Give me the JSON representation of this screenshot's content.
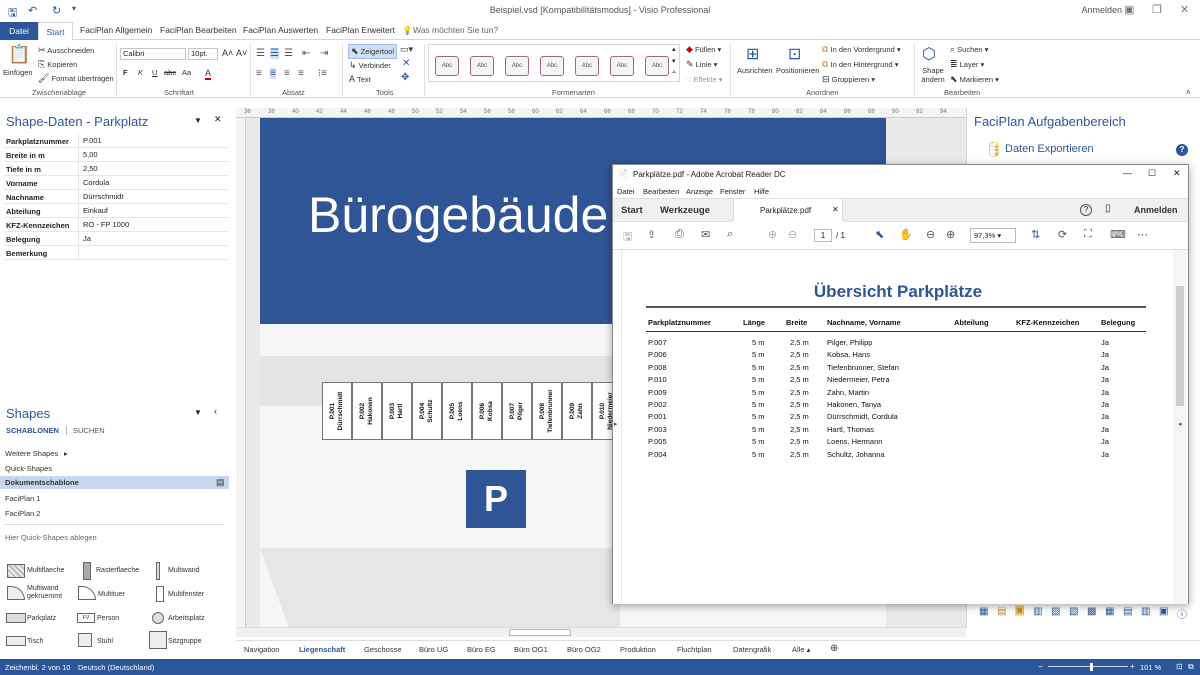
{
  "titlebar": {
    "doc_title": "Beispiel.vsd  [Kompatibilitätsmodus]  -  Visio Professional",
    "signin": "Anmelden"
  },
  "tabs": [
    "Datei",
    "Start",
    "FaciPlan Allgemein",
    "FaciPlan Bearbeiten",
    "FaciPlan Auswerten",
    "FaciPlan Erweitert"
  ],
  "tellme": "Was möchten Sie tun?",
  "ribbon": {
    "clipboard": {
      "paste": "Einfügen",
      "cut": "Ausschneiden",
      "copy": "Kopieren",
      "format": "Format übertragen",
      "group": "Zwischenablage"
    },
    "font": {
      "name": "Calibri",
      "size": "10pt.",
      "bold": "F",
      "italic": "K",
      "underline": "U",
      "strike": "abc",
      "case": "Aa",
      "color": "A",
      "group": "Schriftart"
    },
    "paragraph": {
      "group": "Absatz"
    },
    "tools": {
      "pointer": "Zeigertool",
      "connector": "Verbinder",
      "text": "Text",
      "group": "Tools"
    },
    "styles": {
      "labels": [
        "Abc",
        "Abc",
        "Abc",
        "Abc",
        "Abc",
        "Abc",
        "Abc"
      ],
      "group": "Formenarten"
    },
    "fill": {
      "fill": "Füllen",
      "line": "Linie",
      "effects": "Effekte"
    },
    "arrange": {
      "align": "Ausrichten",
      "position": "Positionieren",
      "front": "In den Vordergrund",
      "back": "In den Hintergrund",
      "group_btn": "Gruppieren",
      "group": "Anordnen"
    },
    "edit": {
      "change_shape": "Shape ändern",
      "find": "Suchen",
      "layer": "Layer",
      "select": "Markieren",
      "group": "Bearbeiten"
    }
  },
  "shapedata": {
    "title": "Shape-Daten - Parkplatz",
    "rows": [
      {
        "k": "Parkplatznummer",
        "v": "P.001"
      },
      {
        "k": "Breite in m",
        "v": "5,00"
      },
      {
        "k": "Tiefe in m",
        "v": "2,50"
      },
      {
        "k": "Vorname",
        "v": "Cordula"
      },
      {
        "k": "Nachname",
        "v": "Dürrschmidt"
      },
      {
        "k": "Abteilung",
        "v": "Einkauf"
      },
      {
        "k": "KFZ-Kennzeichen",
        "v": "RO - FP 1000"
      },
      {
        "k": "Belegung",
        "v": "Ja"
      },
      {
        "k": "Bemerkung",
        "v": ""
      }
    ]
  },
  "shapes": {
    "title": "Shapes",
    "tab_stencils": "SCHABLONEN",
    "tab_search": "SUCHEN",
    "items": [
      "Weitere Shapes",
      "Quick-Shapes",
      "Dokumentschablone",
      "FaciPlan 1",
      "FaciPlan 2"
    ],
    "drop_hint": "Hier Quick-Shapes ablegen",
    "masters": [
      "Multiflaeche",
      "Rasterflaeche",
      "Multiwand",
      "Multiwand gekruemmt",
      "Multituer",
      "Multifenster",
      "Parkplatz",
      "Person",
      "Arbeitsplatz",
      "Tisch",
      "Stuhl",
      "Sitzgruppe"
    ]
  },
  "ruler": [
    "36",
    "38",
    "40",
    "42",
    "44",
    "46",
    "48",
    "50",
    "52",
    "54",
    "56",
    "58",
    "60",
    "62",
    "64",
    "66",
    "68",
    "70",
    "72",
    "74",
    "76",
    "78",
    "80",
    "82",
    "84",
    "86",
    "88",
    "90",
    "92",
    "94"
  ],
  "canvas": {
    "building": "Bürogebäude",
    "parking_sign": "P",
    "spots": [
      {
        "no": "P.001",
        "name": "Dürrschmidt"
      },
      {
        "no": "P.002",
        "name": "Hakonen"
      },
      {
        "no": "P.003",
        "name": "Hartl"
      },
      {
        "no": "P.004",
        "name": "Schultz"
      },
      {
        "no": "P.005",
        "name": "Loens"
      },
      {
        "no": "P.006",
        "name": "Kobsa"
      },
      {
        "no": "P.007",
        "name": "Pilger"
      },
      {
        "no": "P.008",
        "name": "Tiefenbrunner"
      },
      {
        "no": "P.009",
        "name": "Zahn"
      },
      {
        "no": "P.010",
        "name": "Niedermeier"
      }
    ]
  },
  "taskpane": {
    "title": "FaciPlan Aufgabenbereich",
    "export": "Daten Exportieren"
  },
  "pagetabs": [
    "Navigation",
    "Liegenschaft",
    "Geschosse",
    "Büro UG",
    "Büro EG",
    "Büro OG1",
    "Büro OG2",
    "Produktion",
    "Fluchtplan",
    "Datengrafik",
    "Alle ▴"
  ],
  "status": {
    "page": "Zeichenbl. 2 von 10",
    "lang": "Deutsch (Deutschland)",
    "zoom": "101 %"
  },
  "acrobat": {
    "window_title": "Parkplätze.pdf - Adobe Acrobat Reader DC",
    "menu": [
      "Datei",
      "Bearbeiten",
      "Anzeige",
      "Fenster",
      "Hilfe"
    ],
    "tab_home": "Start",
    "tab_tools": "Werkzeuge",
    "tab_file": "Parkplätze.pdf",
    "signin": "Anmelden",
    "page_current": "1",
    "page_total": "/  1",
    "zoom": "97,3%",
    "pdf_title": "Übersicht Parkplätze",
    "headers": [
      "Parkplatznummer",
      "Länge",
      "Breite",
      "Nachname, Vorname",
      "Abteilung",
      "KFZ-Kennzeichen",
      "Belegung"
    ],
    "rows": [
      [
        "P.007",
        "5 m",
        "2,5 m",
        "Pilger, Philipp",
        "",
        "",
        "Ja"
      ],
      [
        "P.006",
        "5 m",
        "2,5 m",
        "Kobsa, Hans",
        "",
        "",
        "Ja"
      ],
      [
        "P.008",
        "5 m",
        "2,5 m",
        "Tiefenbrunner, Stefan",
        "",
        "",
        "Ja"
      ],
      [
        "P.010",
        "5 m",
        "2,5 m",
        "Niedermeier, Petra",
        "",
        "",
        "Ja"
      ],
      [
        "P.009",
        "5 m",
        "2,5 m",
        "Zahn, Martin",
        "",
        "",
        "Ja"
      ],
      [
        "P.002",
        "5 m",
        "2,5 m",
        "Hakonen, Tanya",
        "",
        "",
        "Ja"
      ],
      [
        "P.001",
        "5 m",
        "2,5 m",
        "Dürrschmidt, Cordula",
        "",
        "",
        "Ja"
      ],
      [
        "P.003",
        "5 m",
        "2,5 m",
        "Hartl, Thomas",
        "",
        "",
        "Ja"
      ],
      [
        "P.005",
        "5 m",
        "2,5 m",
        "Loens, Hermann",
        "",
        "",
        "Ja"
      ],
      [
        "P.004",
        "5 m",
        "2,5 m",
        "Schultz, Johanna",
        "",
        "",
        "Ja"
      ]
    ]
  }
}
